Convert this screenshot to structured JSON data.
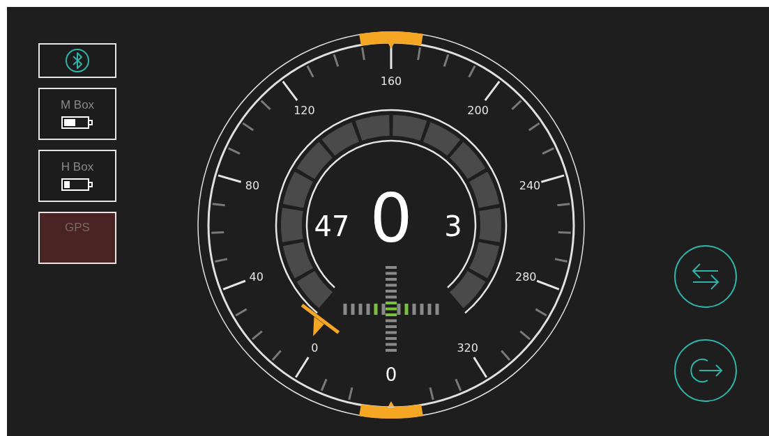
{
  "sidebar": {
    "items": [
      {
        "kind": "bluetooth"
      },
      {
        "kind": "battery",
        "label": "M Box",
        "level": 0.5
      },
      {
        "kind": "battery",
        "label": "H Box",
        "level": 0.25
      },
      {
        "kind": "status",
        "label": "GPS",
        "alert": true
      }
    ]
  },
  "gauge": {
    "scale_labels": [
      "0",
      "40",
      "80",
      "120",
      "160",
      "200",
      "240",
      "280",
      "320"
    ],
    "left_reading": "47",
    "main_reading": "0",
    "right_reading": "3",
    "bottom_reading": "0"
  }
}
